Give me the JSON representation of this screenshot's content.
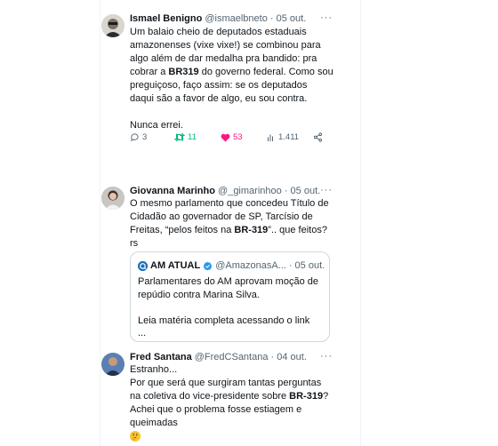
{
  "tweets": [
    {
      "name": "Ismael Benigno",
      "handle": "@ismaelbneto",
      "sep": "·",
      "date": "05 out.",
      "lines": [
        "Um balaio cheio de deputados estaduais",
        "amazonenses (vixe vixe!) se combinou para",
        "algo além de dar medalha pra bandido: pra"
      ],
      "line4_pre": "cobrar a ",
      "line4_bold": "BR319",
      "line4_post": " do governo federal. Como sou",
      "line5": "preguiçoso, faço assim: se os deputados",
      "line6": "daqui são a favor de algo, eu sou contra.",
      "line7": "Nunca errei.",
      "stats": {
        "replies": "3",
        "retweets": "11",
        "likes": "53",
        "views": "1.411"
      },
      "colors": {
        "retweet": "#00ba7c",
        "like": "#f91880"
      }
    },
    {
      "name": "Giovanna Marinho",
      "handle": "@_gimarinhoo",
      "sep": "·",
      "date": "05 out.",
      "line1": "O mesmo parlamento que concedeu Título de",
      "line2": "Cidadão ao governador de SP, Tarcísio de",
      "line3_pre": "Freitas, “pelos feitos na ",
      "line3_bold": "BR-319",
      "line3_post": "”.. que feitos?",
      "line4": "rs",
      "quote": {
        "name": "AM ATUAL",
        "handle": "@AmazonasA...",
        "sep": "·",
        "date": "05 out.",
        "line1": "Parlamentares do AM aprovam moção de",
        "line2": "repúdio contra Marina Silva.",
        "line3": "Leia matéria completa acessando o link",
        "line4": "..."
      }
    },
    {
      "name": "Fred Santana",
      "handle": "@FredCSantana",
      "sep": "·",
      "date": "04 out.",
      "line1": "Estranho...",
      "line2": "Por que será que surgiram tantas perguntas",
      "line3_pre": "na coletiva do vice-presidente sobre ",
      "line3_bold": "BR-319",
      "line3_post": "?",
      "line4": "Achei que o problema fosse estiagem e",
      "line5": "queimadas"
    }
  ],
  "more_label": "···",
  "verified_color": "#1d9bf0",
  "accent": "#1d9bf0"
}
